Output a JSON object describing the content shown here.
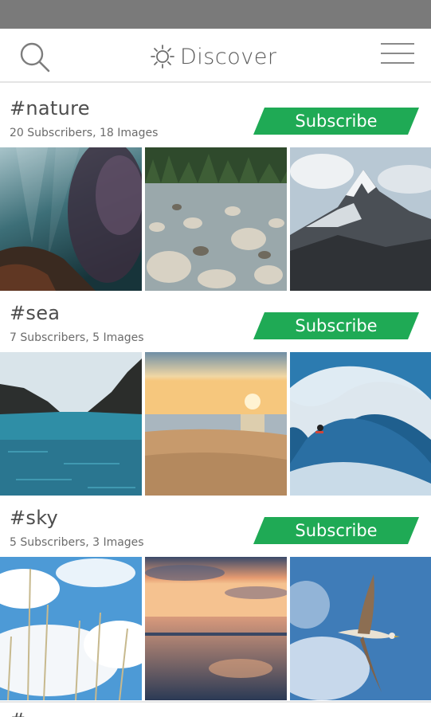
{
  "header": {
    "title": "Discover",
    "icons": {
      "left": "search-icon",
      "title": "sun-icon",
      "right": "hamburger-menu-icon"
    }
  },
  "sections": [
    {
      "tag": "#nature",
      "meta": "20 Subscribers, 18 Images",
      "button": "Subscribe",
      "images": [
        "underwater-kelp-forest",
        "rocky-river-with-forest",
        "snowy-mountain-peak"
      ]
    },
    {
      "tag": "#sea",
      "meta": "7 Subscribers, 5 Images",
      "button": "Subscribe",
      "images": [
        "sea-cove-between-cliffs",
        "beach-at-sunset",
        "surfer-in-wave"
      ]
    },
    {
      "tag": "#sky",
      "meta": "5 Subscribers, 3 Images",
      "button": "Subscribe",
      "images": [
        "clouds-and-grass",
        "sunset-reflection-shore",
        "seagull-flying"
      ]
    }
  ],
  "next_section": {
    "tag": "#"
  },
  "colors": {
    "accent": "#1faa55",
    "status_bar": "#7a7a7a",
    "divider": "#e4e4e4"
  }
}
